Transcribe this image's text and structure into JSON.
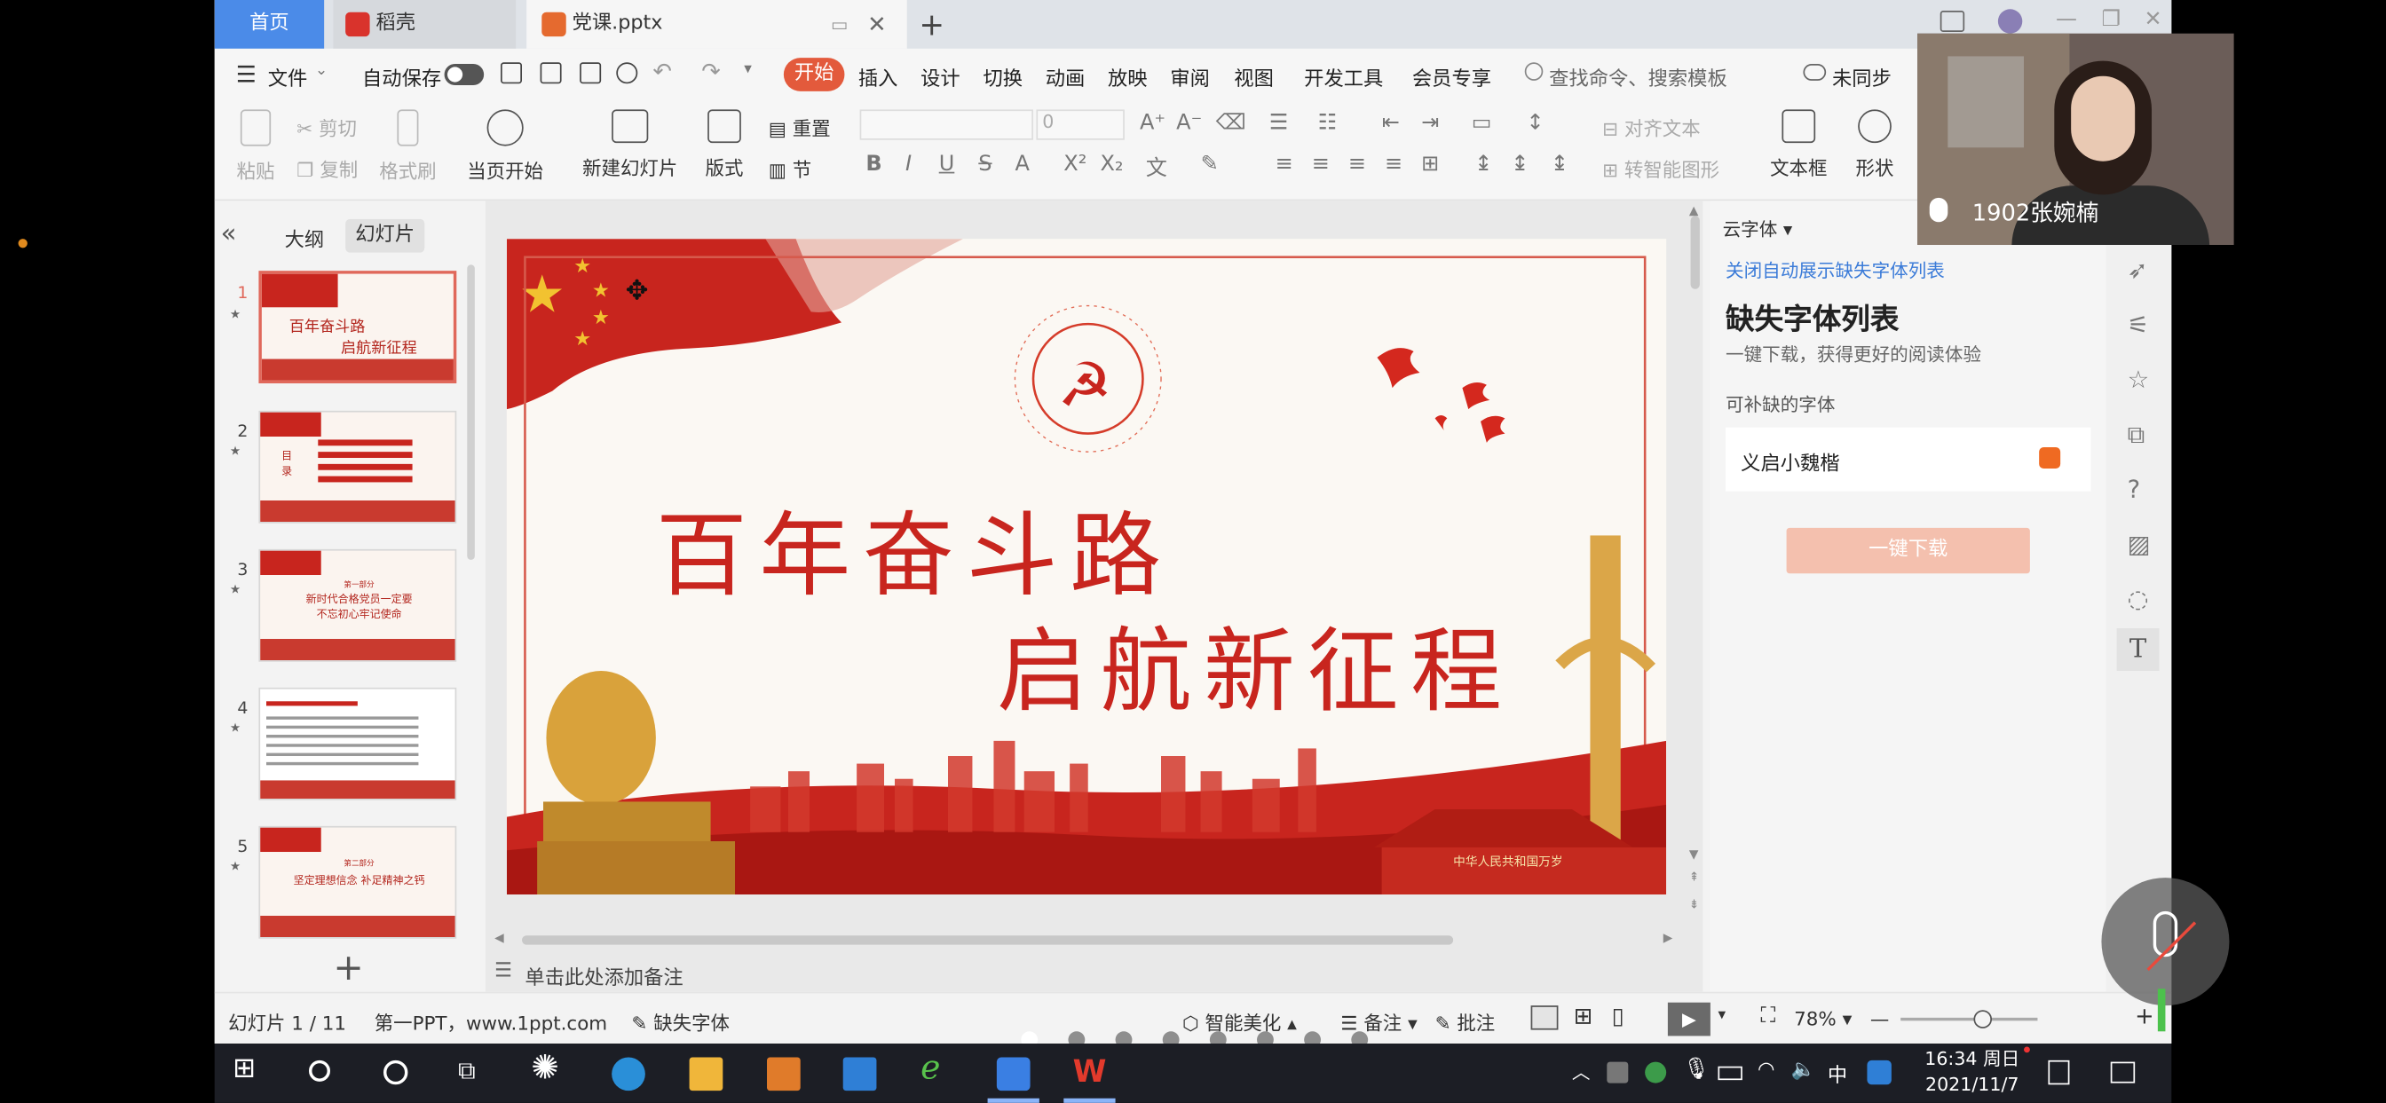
{
  "tabs": {
    "home": "首页",
    "daoke": "稻壳",
    "doc": "党课.pptx",
    "new": "+"
  },
  "menu": {
    "file": "文件",
    "autosave": "自动保存",
    "items": [
      "开始",
      "插入",
      "设计",
      "切换",
      "动画",
      "放映",
      "审阅",
      "视图",
      "开发工具",
      "会员专享"
    ],
    "search": "查找命令、搜索模板",
    "sync": "未同步"
  },
  "ribbon": {
    "paste": "粘贴",
    "cut": "剪切",
    "copy": "复制",
    "format_painter": "格式刷",
    "from_current": "当页开始",
    "new_slide": "新建幻灯片",
    "layout": "版式",
    "reset": "重置",
    "section": "节",
    "font_size": "0",
    "align_text": "对齐文本",
    "smart_shape": "转智能图形",
    "textbox": "文本框",
    "shape": "形状"
  },
  "panel": {
    "outline": "大纲",
    "slides": "幻灯片",
    "collapse": "«"
  },
  "thumbs": [
    {
      "n": "1",
      "lines": [
        "百年奋斗路",
        "启航新征程"
      ]
    },
    {
      "n": "2",
      "lines": [
        "目录"
      ]
    },
    {
      "n": "3",
      "lines": [
        "第一部分",
        "新时代合格党员一定要",
        "不忘初心牢记使命"
      ]
    },
    {
      "n": "4",
      "lines": [
        ""
      ]
    },
    {
      "n": "5",
      "lines": [
        "第二部分",
        "坚定理想信念 补足精神之钙"
      ]
    }
  ],
  "add_slide": "+",
  "slide": {
    "title1": "百年奋斗路",
    "title2": "启航新征程",
    "gate_text": "中华人民共和国万岁"
  },
  "notes": "单击此处添加备注",
  "right_panel": {
    "cloud_font": "云字体",
    "close_link": "关闭自动展示缺失字体列表",
    "title": "缺失字体列表",
    "subtitle": "一键下载，获得更好的阅读体验",
    "section": "可补缺的字体",
    "font_name": "义启小魏楷",
    "download": "一键下载"
  },
  "status": {
    "slide_count": "幻灯片 1 / 11",
    "theme": "第一PPT，www.1ppt.com",
    "missing_font": "缺失字体",
    "beautify": "智能美化",
    "notes": "备注",
    "comment": "批注",
    "zoom": "78%"
  },
  "taskbar": {
    "time": "16:34 周日",
    "date": "2021/11/7"
  },
  "video": {
    "name": "1902张婉楠"
  },
  "colors": {
    "accent": "#e35a3c",
    "red": "#c8251e",
    "gold": "#d9a23b"
  }
}
